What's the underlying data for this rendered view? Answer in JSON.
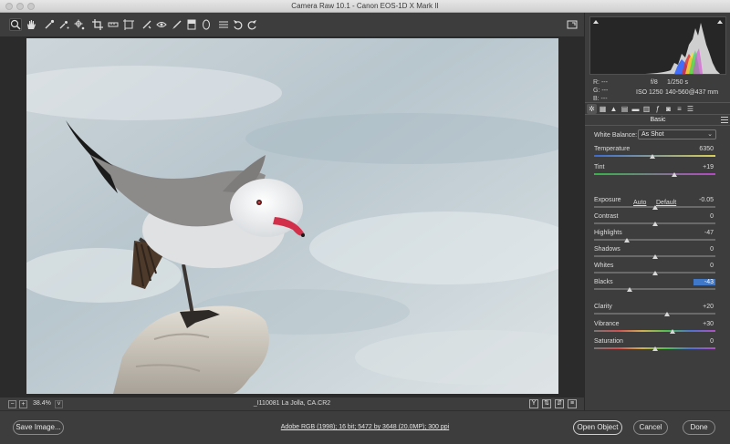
{
  "window": {
    "title": "Camera Raw 10.1  -  Canon EOS-1D X Mark II"
  },
  "toolbar": {
    "tools": [
      {
        "name": "zoom-tool-icon",
        "glyph": "zoom"
      },
      {
        "name": "hand-tool-icon",
        "glyph": "hand"
      },
      {
        "name": "white-balance-tool-icon",
        "glyph": "eyedropper"
      },
      {
        "name": "color-sampler-tool-icon",
        "glyph": "sampler"
      },
      {
        "name": "targeted-adjustment-tool-icon",
        "glyph": "target"
      },
      {
        "name": "crop-tool-icon",
        "glyph": "crop"
      },
      {
        "name": "straighten-tool-icon",
        "glyph": "level"
      },
      {
        "name": "transform-tool-icon",
        "glyph": "transform"
      },
      {
        "name": "spot-removal-tool-icon",
        "glyph": "brush2"
      },
      {
        "name": "red-eye-tool-icon",
        "glyph": "eye"
      },
      {
        "name": "adjustment-brush-icon",
        "glyph": "brush"
      },
      {
        "name": "graduated-filter-icon",
        "glyph": "gradient"
      },
      {
        "name": "radial-filter-icon",
        "glyph": "ellipse"
      },
      {
        "name": "preferences-icon",
        "glyph": "list"
      },
      {
        "name": "rotate-ccw-icon",
        "glyph": "rotl"
      },
      {
        "name": "rotate-cw-icon",
        "glyph": "rotr"
      }
    ]
  },
  "histogram": {
    "rgb": {
      "r": "R:  ---",
      "g": "G:  ---",
      "b": "B:  ---"
    },
    "aperture": "f/8",
    "shutter": "1/250 s",
    "iso": "ISO 1250",
    "lens": "140-560@437 mm"
  },
  "panel": {
    "section_title": "Basic",
    "white_balance_label": "White Balance:",
    "white_balance_value": "As Shot",
    "auto_label": "Auto",
    "default_label": "Default",
    "sliders": {
      "temperature": {
        "label": "Temperature",
        "value": "6350",
        "pos": 0.48
      },
      "tint": {
        "label": "Tint",
        "value": "+19",
        "pos": 0.66
      },
      "exposure": {
        "label": "Exposure",
        "value": "-0.05",
        "pos": 0.5
      },
      "contrast": {
        "label": "Contrast",
        "value": "0",
        "pos": 0.5
      },
      "highlights": {
        "label": "Highlights",
        "value": "-47",
        "pos": 0.27
      },
      "shadows": {
        "label": "Shadows",
        "value": "0",
        "pos": 0.5
      },
      "whites": {
        "label": "Whites",
        "value": "0",
        "pos": 0.5
      },
      "blacks": {
        "label": "Blacks",
        "value": "-43",
        "pos": 0.29
      },
      "clarity": {
        "label": "Clarity",
        "value": "+20",
        "pos": 0.6
      },
      "vibrance": {
        "label": "Vibrance",
        "value": "+30",
        "pos": 0.65
      },
      "saturation": {
        "label": "Saturation",
        "value": "0",
        "pos": 0.5
      }
    }
  },
  "status": {
    "zoom": "38.4%",
    "filename": "_I110081 La Jolla, CA.CR2"
  },
  "footer": {
    "save_label": "Save Image...",
    "workflow": "Adobe RGB (1998); 16 bit; 5472 by 3648 (20.0MP); 300 ppi",
    "open_label": "Open Object",
    "cancel_label": "Cancel",
    "done_label": "Done"
  },
  "colors": {
    "accent": "#3f78c9",
    "panel_bg": "#3d3d3d",
    "canvas_bg": "#2b2b2b"
  }
}
